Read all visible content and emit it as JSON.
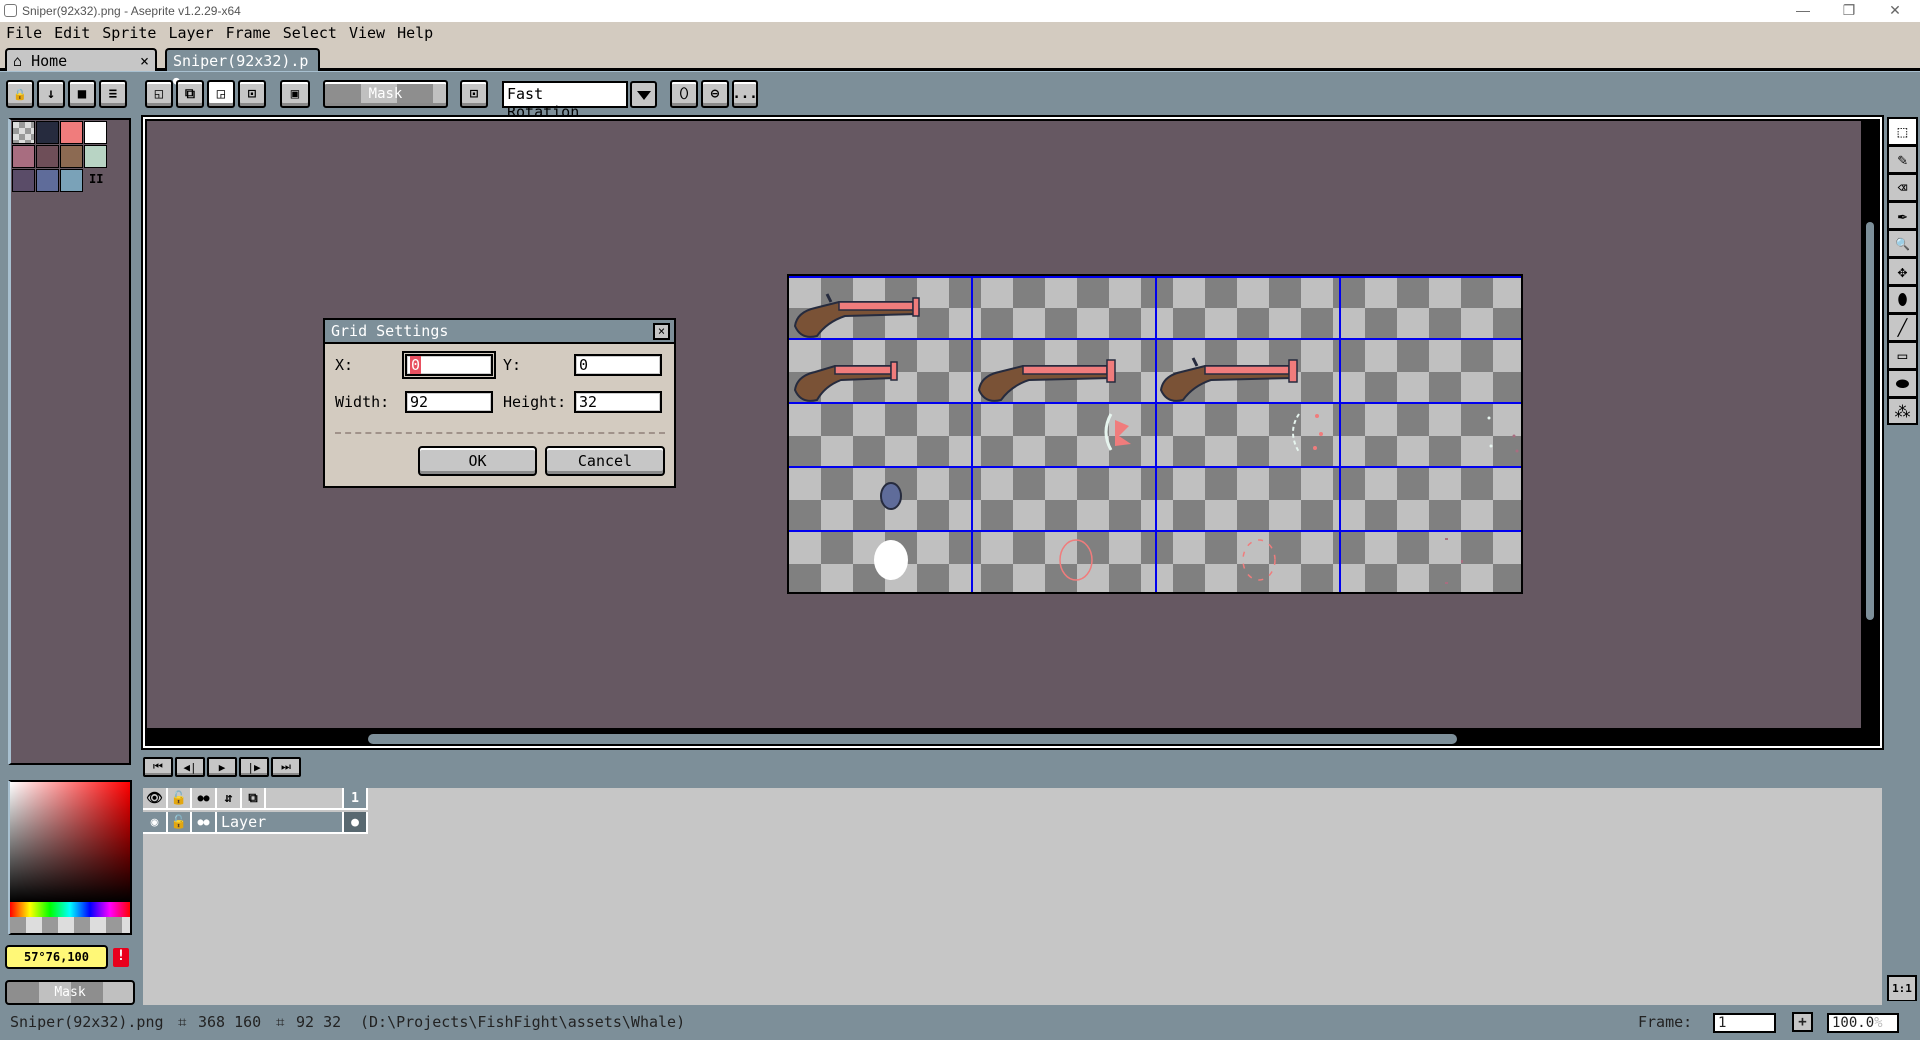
{
  "window": {
    "title": "Sniper(92x32).png - Aseprite v1.2.29-x64",
    "minimize": "—",
    "restore": "❐",
    "close": "✕"
  },
  "menu": [
    {
      "label": "File",
      "accel": "F"
    },
    {
      "label": "Edit",
      "accel": "E"
    },
    {
      "label": "Sprite",
      "accel": "S"
    },
    {
      "label": "Layer",
      "accel": "L"
    },
    {
      "label": "Frame",
      "accel": "r"
    },
    {
      "label": "Select",
      "accel": "t"
    },
    {
      "label": "View",
      "accel": "V"
    },
    {
      "label": "Help",
      "accel": "H"
    }
  ],
  "tabs": [
    {
      "label": "Home",
      "icon": "home-icon",
      "close": "×"
    },
    {
      "label": "Sniper(92x32).p",
      "modified_dot": "●"
    }
  ],
  "toolbar": {
    "lock_icon": "🔒",
    "down_icon": "↓",
    "doc_icon": "■",
    "menu_icon": "≡",
    "mask_label": "Mask",
    "rotation_algorithm": "Fast Rotation",
    "more_label": "..."
  },
  "palette": {
    "colors": [
      "#transparent",
      "#262b3e",
      "#f07c7c",
      "#ffffff",
      "#a86d80",
      "#6e4e58",
      "#8c6a52",
      "#b8d4c4",
      "#5a4c68",
      "#5f6c9a",
      "#7aa2b8"
    ],
    "resize_handle": "II"
  },
  "canvas": {
    "background": "#665862",
    "grid_color": "#0000ee",
    "sprite_cols": 4,
    "sprite_rows": 5
  },
  "tools": [
    {
      "name": "rectangular-marquee",
      "glyph": "⬚"
    },
    {
      "name": "pencil",
      "glyph": "✎"
    },
    {
      "name": "eraser",
      "glyph": "⌫"
    },
    {
      "name": "eyedropper",
      "glyph": "✒"
    },
    {
      "name": "zoom",
      "glyph": "🔍"
    },
    {
      "name": "move",
      "glyph": "✥"
    },
    {
      "name": "paint-bucket",
      "glyph": "⬮"
    },
    {
      "name": "line",
      "glyph": "╱"
    },
    {
      "name": "rectangle",
      "glyph": "▭"
    },
    {
      "name": "contour",
      "glyph": "⬬"
    },
    {
      "name": "spray",
      "glyph": "⁂"
    }
  ],
  "timeline": {
    "buttons": [
      {
        "name": "first-frame",
        "glyph": "⏮"
      },
      {
        "name": "previous-frame",
        "glyph": "◀|"
      },
      {
        "name": "play",
        "glyph": "▶"
      },
      {
        "name": "next-frame",
        "glyph": "|▶"
      },
      {
        "name": "last-frame",
        "glyph": "⏭"
      }
    ],
    "header_icons": {
      "visibility": "👁",
      "lock": "🔓",
      "onion": "●●",
      "link": "⇵",
      "new_layer": "⧉"
    },
    "frame_number": "1",
    "layers": [
      {
        "name": "Layer",
        "cel": "●"
      }
    ]
  },
  "color": {
    "readout": "57°76,100",
    "warning": "!",
    "mask_label": "Mask"
  },
  "dialog": {
    "title": "Grid Settings",
    "close": "×",
    "x_label": "X:",
    "x_value": "0",
    "y_label": "Y:",
    "y_value": "0",
    "width_label": "Width:",
    "width_value": "92",
    "height_label": "Height:",
    "height_value": "32",
    "ok_label": "OK",
    "cancel_label": "Cancel"
  },
  "status": {
    "filename": "Sniper(92x32).png",
    "size_icon": "⌗",
    "sprite_size": "368 160",
    "selection_icon": "⌗",
    "selection_size": "92 32",
    "path": "(D:\\Projects\\FishFight\\assets\\Whale)",
    "frame_label": "Frame:",
    "frame_value": "1",
    "add_frame": "+",
    "zoom_value": "100.0",
    "zoom_unit": "%",
    "one_to_one": "1:1"
  }
}
